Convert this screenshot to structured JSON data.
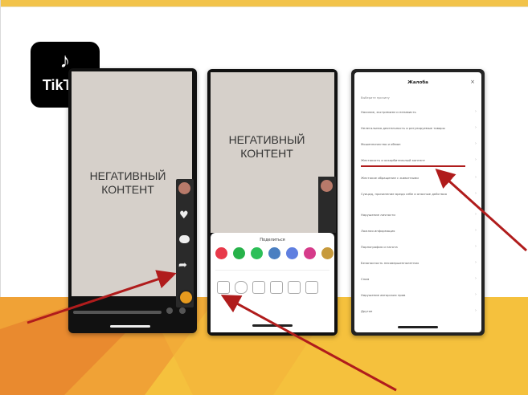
{
  "logo": {
    "name": "TikTok",
    "icon": "tiktok-note-icon"
  },
  "panels": {
    "left": {
      "negative_text": [
        "НЕГАТИВНЫЙ",
        "КОНТЕНТ"
      ]
    },
    "middle": {
      "negative_text": [
        "НЕГАТИВНЫЙ",
        "КОНТЕНТ"
      ],
      "share_title": "Поделиться"
    },
    "right": {
      "title": "Жалоба",
      "close_icon": "close-icon",
      "subtitle": "Выберите причину",
      "reasons": [
        "Насилие, экстремизм и ненависть",
        "Нелегальная деятельность и регулируемые товары",
        "Мошенничество и обман",
        "Жестокость и оскорбительный контент",
        "Жестокое обращение с животными",
        "Суицид, причинение вреда себе и опасные действия",
        "Нарушение личности",
        "Ложная информация",
        "Порнография и нагота",
        "Безопасность несовершеннолетних",
        "Спам",
        "Нарушение авторских прав",
        "Другое"
      ]
    }
  },
  "colors": {
    "accent_yellow": "#f2c34a",
    "arrow_red": "#b01c1c",
    "orange": "#e88a2c"
  }
}
